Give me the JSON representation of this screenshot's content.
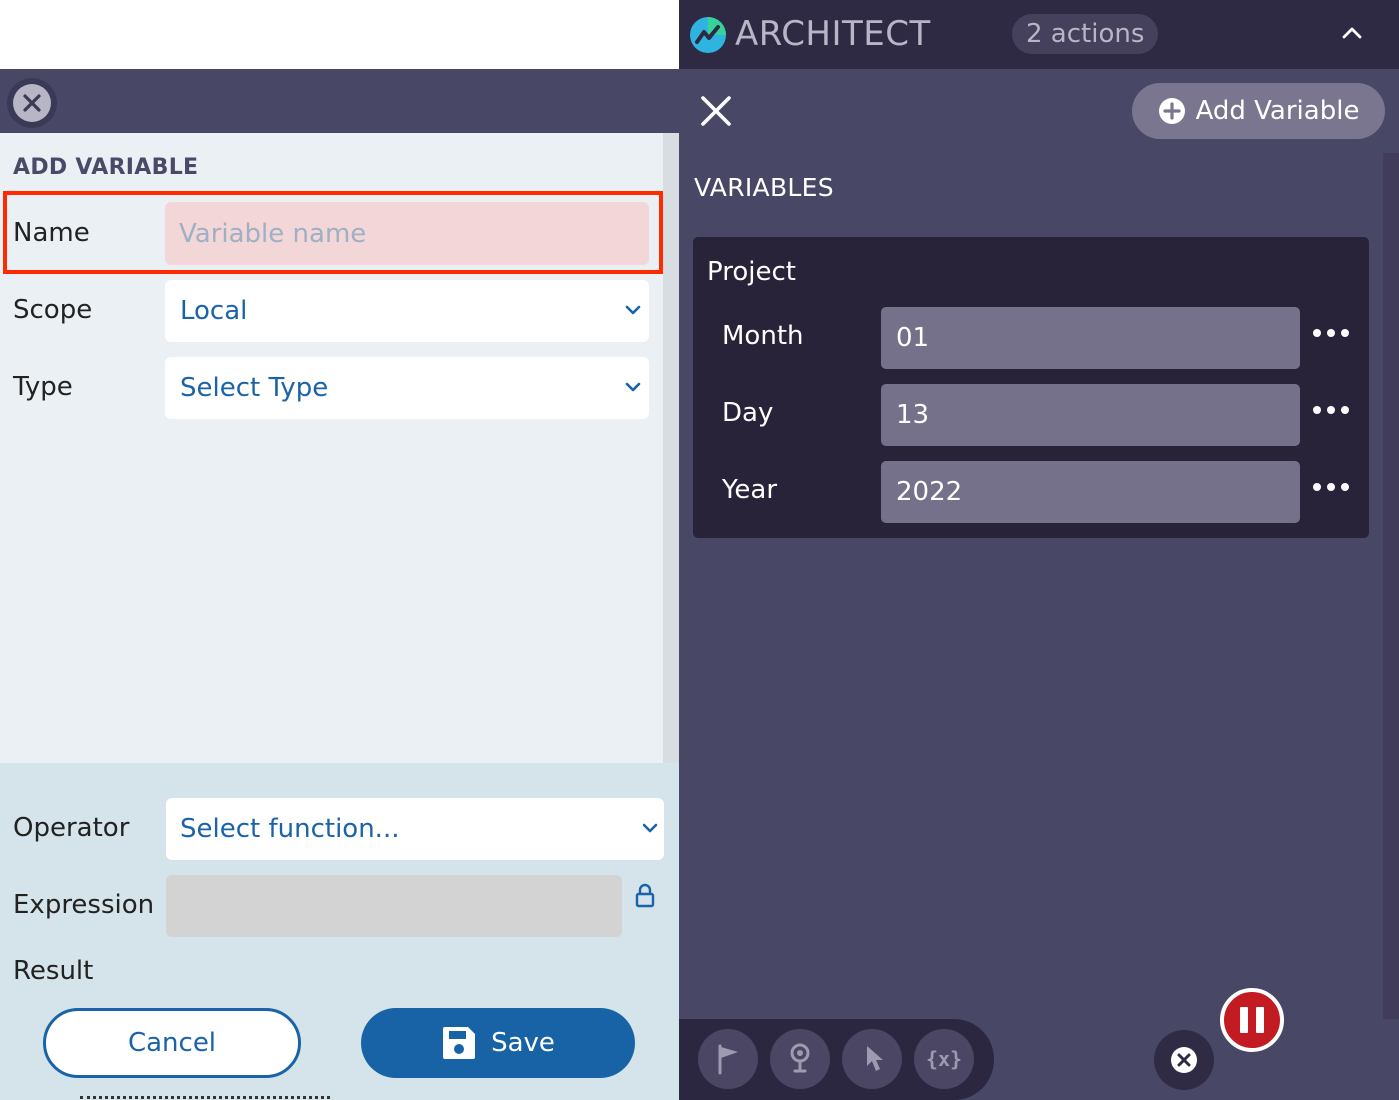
{
  "add_variable_form": {
    "section_title": "ADD VARIABLE",
    "name_label": "Name",
    "name_placeholder": "Variable name",
    "scope_label": "Scope",
    "scope_value": "Local",
    "type_label": "Type",
    "type_value": "Select Type",
    "operator_label": "Operator",
    "operator_value": "Select function...",
    "expression_label": "Expression",
    "result_label": "Result",
    "cancel_label": "Cancel",
    "save_label": "Save"
  },
  "architect": {
    "app_title": "ARCHITECT",
    "actions_badge": "2 actions",
    "add_variable_label": "Add Variable",
    "variables_title": "VARIABLES",
    "project": {
      "name": "Project",
      "variables": [
        {
          "label": "Month",
          "value": "01"
        },
        {
          "label": "Day",
          "value": "13"
        },
        {
          "label": "Year",
          "value": "2022"
        }
      ]
    },
    "toolbar": {
      "variable_tool_glyph": "{x}"
    }
  },
  "colors": {
    "primary_blue": "#1763a6",
    "highlight_red": "#ff2a00",
    "panel_dark": "#484866",
    "card_dark": "#29233a",
    "pause_red": "#c21b22"
  },
  "icons": [
    "close-icon",
    "chevron-down-icon",
    "lock-icon",
    "save-icon",
    "logo-icon",
    "chevron-up-icon",
    "plus-circle-icon",
    "more-icon",
    "flag-icon",
    "pin-icon",
    "pointer-icon",
    "variable-icon",
    "pause-icon"
  ]
}
